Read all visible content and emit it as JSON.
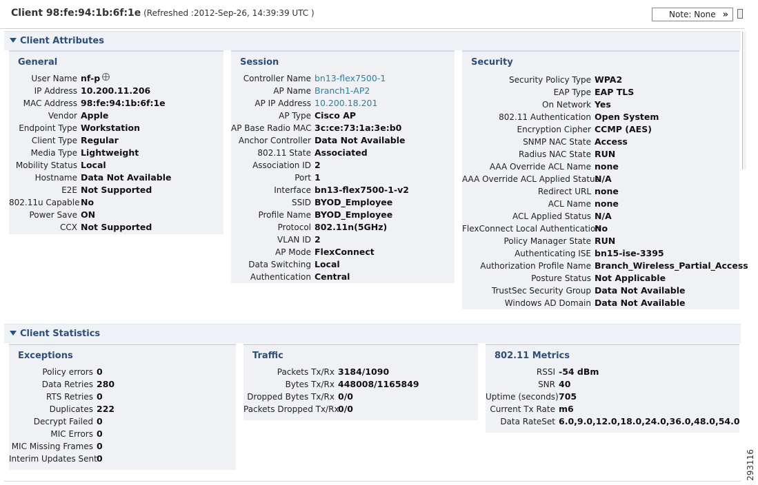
{
  "header": {
    "client_label": "Client 98:fe:94:1b:6f:1e",
    "refreshed": "(Refreshed :2012-Sep-26, 14:39:39 UTC )",
    "note_label": "Note: None",
    "note_icon": "double-chevron-right-icon"
  },
  "attributes": {
    "title": "Client Attributes",
    "general": {
      "title": "General",
      "rows": [
        {
          "k": "User Name",
          "v": "nf-p"
        },
        {
          "k": "IP Address",
          "v": "10.200.11.206"
        },
        {
          "k": "MAC Address",
          "v": "98:fe:94:1b:6f:1e"
        },
        {
          "k": "Vendor",
          "v": "Apple"
        },
        {
          "k": "Endpoint Type",
          "v": "Workstation"
        },
        {
          "k": "Client Type",
          "v": "Regular"
        },
        {
          "k": "Media Type",
          "v": "Lightweight"
        },
        {
          "k": "Mobility Status",
          "v": "Local"
        },
        {
          "k": "Hostname",
          "v": "Data Not Available"
        },
        {
          "k": "E2E",
          "v": "Not Supported"
        },
        {
          "k": "802.11u Capable",
          "v": "No"
        },
        {
          "k": "Power Save",
          "v": "ON"
        },
        {
          "k": "CCX",
          "v": "Not Supported"
        }
      ]
    },
    "session": {
      "title": "Session",
      "rows": [
        {
          "k": "Controller Name",
          "v": "bn13-flex7500-1"
        },
        {
          "k": "AP Name",
          "v": "Branch1-AP2"
        },
        {
          "k": "AP IP Address",
          "v": "10.200.18.201"
        },
        {
          "k": "AP Type",
          "v": "Cisco AP"
        },
        {
          "k": "AP Base Radio MAC",
          "v": "3c:ce:73:1a:3e:b0"
        },
        {
          "k": "Anchor Controller",
          "v": "Data Not Available"
        },
        {
          "k": "802.11 State",
          "v": "Associated"
        },
        {
          "k": "Association ID",
          "v": "2"
        },
        {
          "k": "Port",
          "v": "1"
        },
        {
          "k": "Interface",
          "v": "bn13-flex7500-1-v2"
        },
        {
          "k": "SSID",
          "v": "BYOD_Employee"
        },
        {
          "k": "Profile Name",
          "v": "BYOD_Employee"
        },
        {
          "k": "Protocol",
          "v": "802.11n(5GHz)"
        },
        {
          "k": "VLAN ID",
          "v": "2"
        },
        {
          "k": "AP Mode",
          "v": "FlexConnect"
        },
        {
          "k": "Data Switching",
          "v": "Local"
        },
        {
          "k": "Authentication",
          "v": "Central"
        }
      ]
    },
    "security": {
      "title": "Security",
      "rows": [
        {
          "k": "Security Policy Type",
          "v": "WPA2"
        },
        {
          "k": "EAP Type",
          "v": "EAP TLS"
        },
        {
          "k": "On Network",
          "v": "Yes"
        },
        {
          "k": "802.11 Authentication",
          "v": "Open System"
        },
        {
          "k": "Encryption Cipher",
          "v": "CCMP (AES)"
        },
        {
          "k": "SNMP NAC State",
          "v": "Access"
        },
        {
          "k": "Radius NAC State",
          "v": "RUN"
        },
        {
          "k": "AAA Override ACL Name",
          "v": "none"
        },
        {
          "k": "AAA Override ACL Applied Status",
          "v": "N/A"
        },
        {
          "k": "Redirect URL",
          "v": "none"
        },
        {
          "k": "ACL Name",
          "v": "none"
        },
        {
          "k": "ACL Applied Status",
          "v": "N/A"
        },
        {
          "k": "FlexConnect Local Authentication",
          "v": "No"
        },
        {
          "k": "Policy Manager State",
          "v": "RUN"
        },
        {
          "k": "Authenticating ISE",
          "v": "bn15-ise-3395"
        },
        {
          "k": "Authorization Profile Name",
          "v": "Branch_Wireless_Partial_Access"
        },
        {
          "k": "Posture Status",
          "v": "Not Applicable"
        },
        {
          "k": "TrustSec Security Group",
          "v": "Data Not Available"
        },
        {
          "k": "Windows AD Domain",
          "v": "Data Not Available"
        }
      ]
    }
  },
  "statistics": {
    "title": "Client Statistics",
    "exceptions": {
      "title": "Exceptions",
      "rows": [
        {
          "k": "Policy errors",
          "v": "0"
        },
        {
          "k": "Data Retries",
          "v": "280"
        },
        {
          "k": "RTS Retries",
          "v": "0"
        },
        {
          "k": "Duplicates",
          "v": "222"
        },
        {
          "k": "Decrypt Failed",
          "v": "0"
        },
        {
          "k": "MIC Errors",
          "v": "0"
        },
        {
          "k": "MIC Missing Frames",
          "v": "0"
        },
        {
          "k": "Interim Updates Sent",
          "v": "0"
        }
      ]
    },
    "traffic": {
      "title": "Traffic",
      "rows": [
        {
          "k": "Packets Tx/Rx",
          "v": "3184/1090"
        },
        {
          "k": "Bytes Tx/Rx",
          "v": "448008/1165849"
        },
        {
          "k": "Dropped Bytes Tx/Rx",
          "v": "0/0"
        },
        {
          "k": "Packets Dropped Tx/Rx",
          "v": "0/0"
        }
      ]
    },
    "metrics": {
      "title": "802.11 Metrics",
      "rows": [
        {
          "k": "RSSI",
          "v": "-54 dBm"
        },
        {
          "k": "SNR",
          "v": "40"
        },
        {
          "k": "Uptime (seconds)",
          "v": "705"
        },
        {
          "k": "Current Tx Rate",
          "v": "m6"
        },
        {
          "k": "Data RateSet",
          "v": "6.0,9.0,12.0,18.0,24.0,36.0,48.0,54.0"
        }
      ]
    }
  },
  "figure_number": "293116"
}
